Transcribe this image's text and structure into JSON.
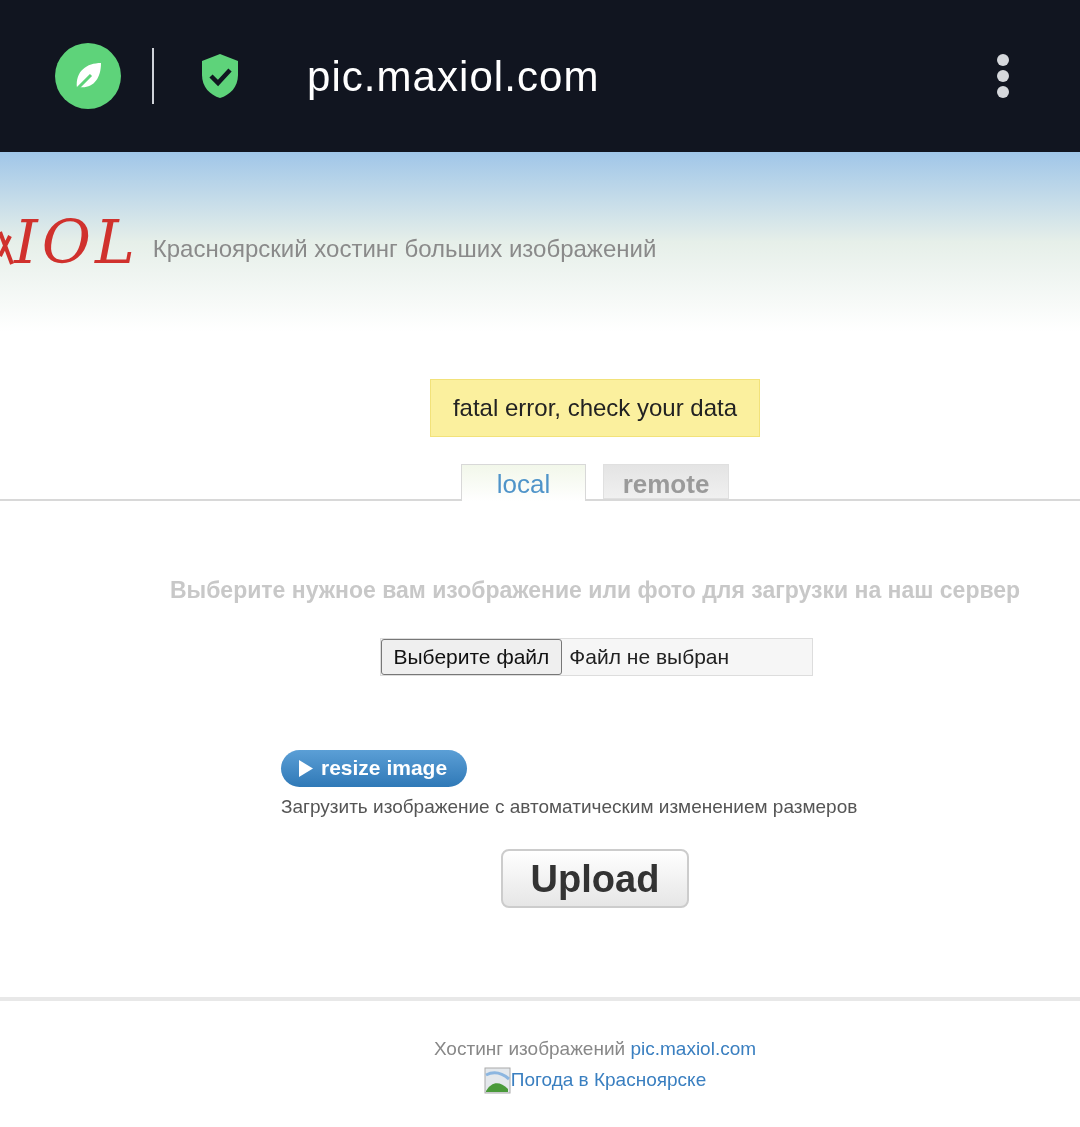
{
  "browser": {
    "url": "pic.maxiol.com"
  },
  "header": {
    "logo": "IOL",
    "tagline": "Красноярский хостинг больших изображений"
  },
  "error": "fatal error, check your data",
  "tabs": [
    {
      "label": "local",
      "selected": true
    },
    {
      "label": "remote",
      "selected": false
    }
  ],
  "prompt": "Выберите нужное вам изображение или фото для загрузки на наш сервер",
  "file_input": {
    "button": "Выберите файл",
    "status": "Файл не выбран"
  },
  "resize": {
    "label": "resize image",
    "description": "Загрузить изображение с автоматическим изменением размеров"
  },
  "upload_button": "Upload",
  "footer": {
    "text": "Хостинг изображений",
    "link": "pic.maxiol.com",
    "weather_link": "Погода в Красноярске"
  }
}
